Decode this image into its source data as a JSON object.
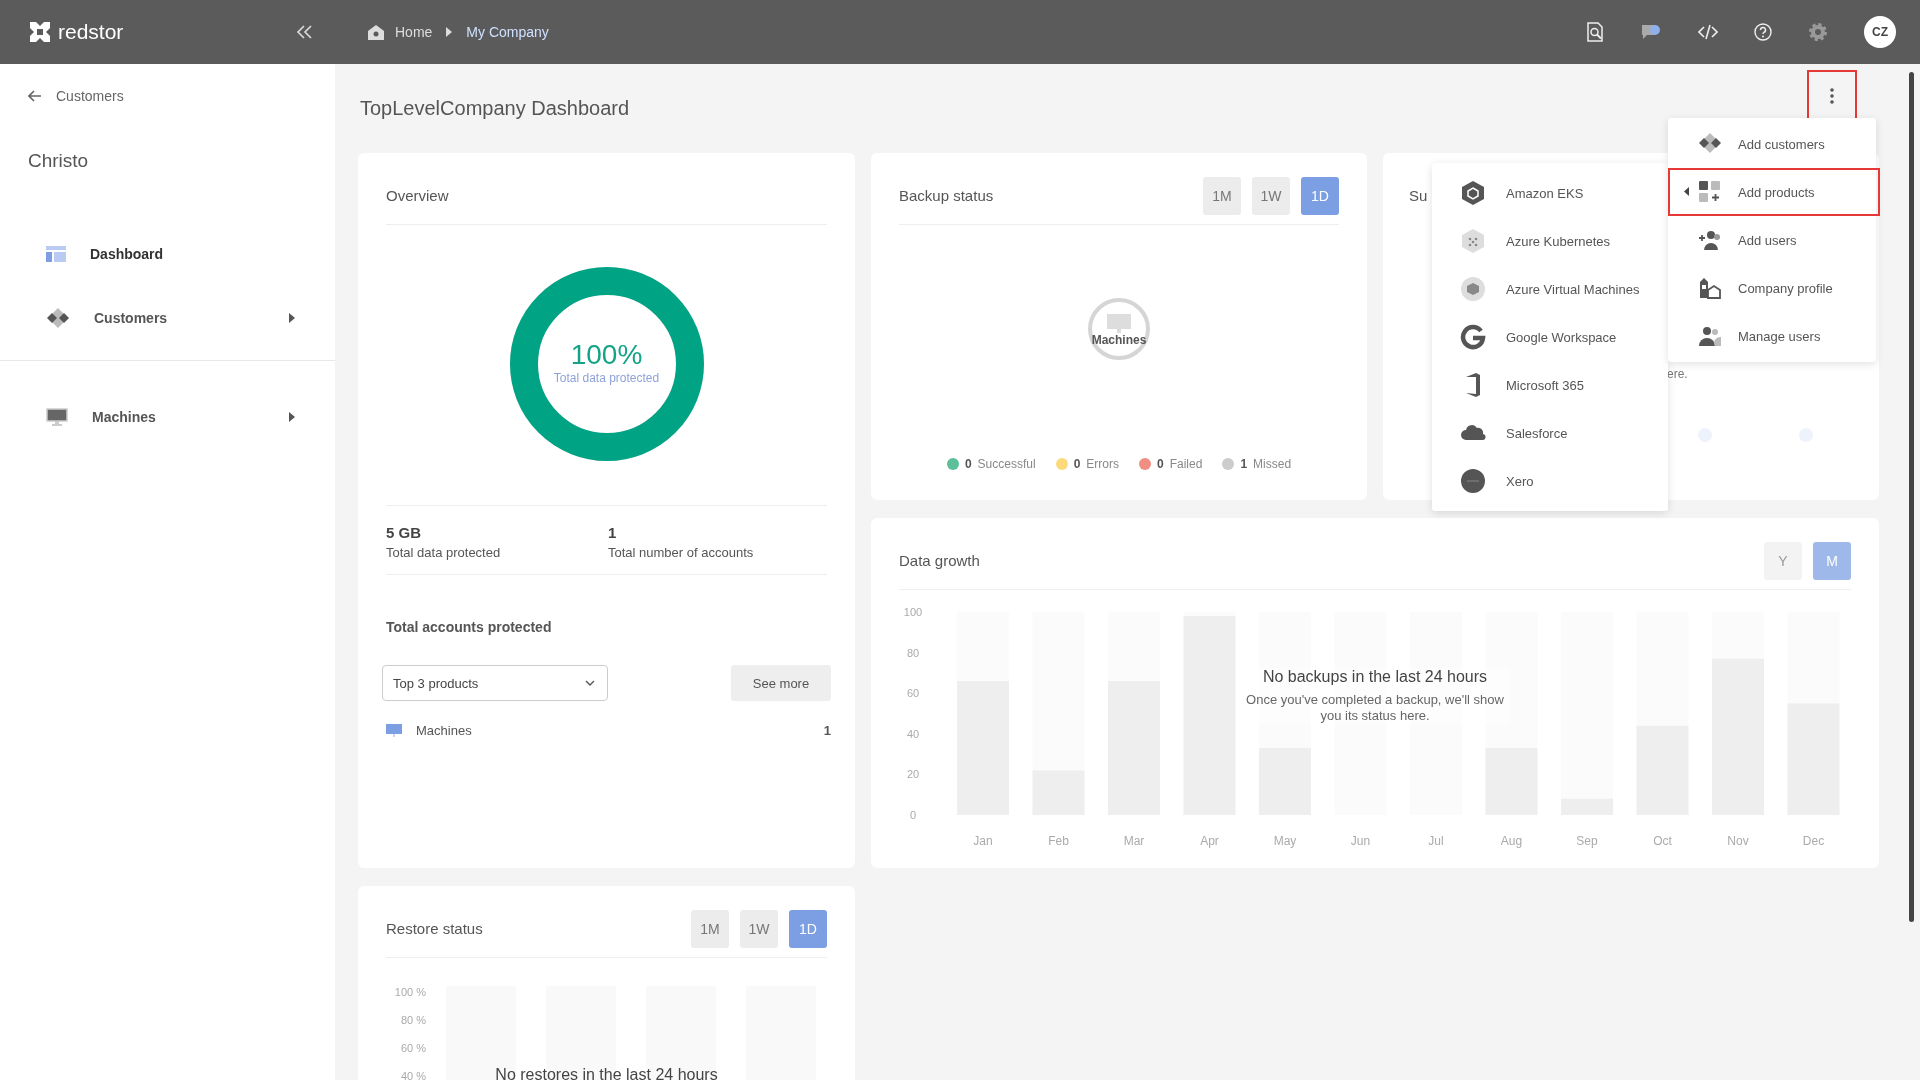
{
  "topbar": {
    "logo": "redstor",
    "breadcrumb": [
      {
        "label": "Home",
        "current": false
      },
      {
        "label": "My Company",
        "current": true
      }
    ],
    "avatar": "CZ"
  },
  "sidebar": {
    "back": "Customers",
    "title": "Christo",
    "groups": [
      [
        {
          "label": "Dashboard",
          "selected": true,
          "expandable": false
        },
        {
          "label": "Customers",
          "selected": false,
          "expandable": true
        }
      ],
      [
        {
          "label": "Machines",
          "selected": false,
          "expandable": true
        }
      ]
    ]
  },
  "page": {
    "title": "TopLevelCompany Dashboard",
    "menu_highlighted": true
  },
  "overview": {
    "title": "Overview",
    "donut": {
      "value": "100%",
      "label": "Total data protected",
      "level": 1
    },
    "stats": [
      {
        "value": "5 GB",
        "label": "Total data protected"
      },
      {
        "value": "1",
        "label": "Total number of accounts"
      }
    ],
    "accounts_title": "Total accounts protected",
    "dropdown": "Top 3 products",
    "see_more": "See more",
    "products": [
      {
        "name": "Machines",
        "count": "1"
      }
    ]
  },
  "backup_status": {
    "title": "Backup status",
    "ranges": [
      {
        "label": "1M",
        "selected": false
      },
      {
        "label": "1W",
        "selected": false
      },
      {
        "label": "1D",
        "selected": true
      }
    ],
    "center_label": "Machines",
    "legend": [
      {
        "count": "0",
        "label": "Successful",
        "color": "#5cbf9a"
      },
      {
        "count": "0",
        "label": "Errors",
        "color": "#fcd97a"
      },
      {
        "count": "0",
        "label": "Failed",
        "color": "#ef8f82"
      },
      {
        "count": "1",
        "label": "Missed",
        "color": "#cccccc"
      }
    ]
  },
  "hidden_card": {
    "title": "Su",
    "text": "ere."
  },
  "data_growth": {
    "title": "Data growth",
    "ranges": [
      {
        "label": "Y",
        "selected": false
      },
      {
        "label": "M",
        "selected": true
      }
    ],
    "empty_title": "No backups in the last 24 hours",
    "empty_text": "Once you've completed a backup, we'll show you its status here.",
    "chart_data": {
      "type": "bar",
      "categories": [
        "Jan",
        "Feb",
        "Mar",
        "Apr",
        "May",
        "Jun",
        "Jul",
        "Aug",
        "Sep",
        "Oct",
        "Nov",
        "Dec"
      ],
      "values": [
        66,
        22,
        66,
        98,
        33,
        null,
        null,
        33,
        8,
        44,
        77,
        55
      ],
      "ylim": [
        0,
        100
      ],
      "yticks": [
        0,
        20,
        40,
        60,
        80,
        100
      ]
    }
  },
  "restore_status": {
    "title": "Restore status",
    "ranges": [
      {
        "label": "1M",
        "selected": false
      },
      {
        "label": "1W",
        "selected": false
      },
      {
        "label": "1D",
        "selected": true
      }
    ],
    "y_labels": [
      "100 %",
      "80 %",
      "60 %",
      "40 %"
    ],
    "empty_title": "No restores in the last 24 hours"
  },
  "actions_menu": [
    {
      "label": "Add customers",
      "highlighted": false,
      "submenu": false
    },
    {
      "label": "Add products",
      "highlighted": true,
      "submenu": true
    },
    {
      "label": "Add users",
      "highlighted": false,
      "submenu": false
    },
    {
      "label": "Company profile",
      "highlighted": false,
      "submenu": false
    },
    {
      "label": "Manage users",
      "highlighted": false,
      "submenu": false
    }
  ],
  "products_menu": [
    {
      "label": "Amazon EKS"
    },
    {
      "label": "Azure Kubernetes"
    },
    {
      "label": "Azure Virtual Machines"
    },
    {
      "label": "Google Workspace"
    },
    {
      "label": "Microsoft 365"
    },
    {
      "label": "Salesforce"
    },
    {
      "label": "Xero"
    }
  ]
}
